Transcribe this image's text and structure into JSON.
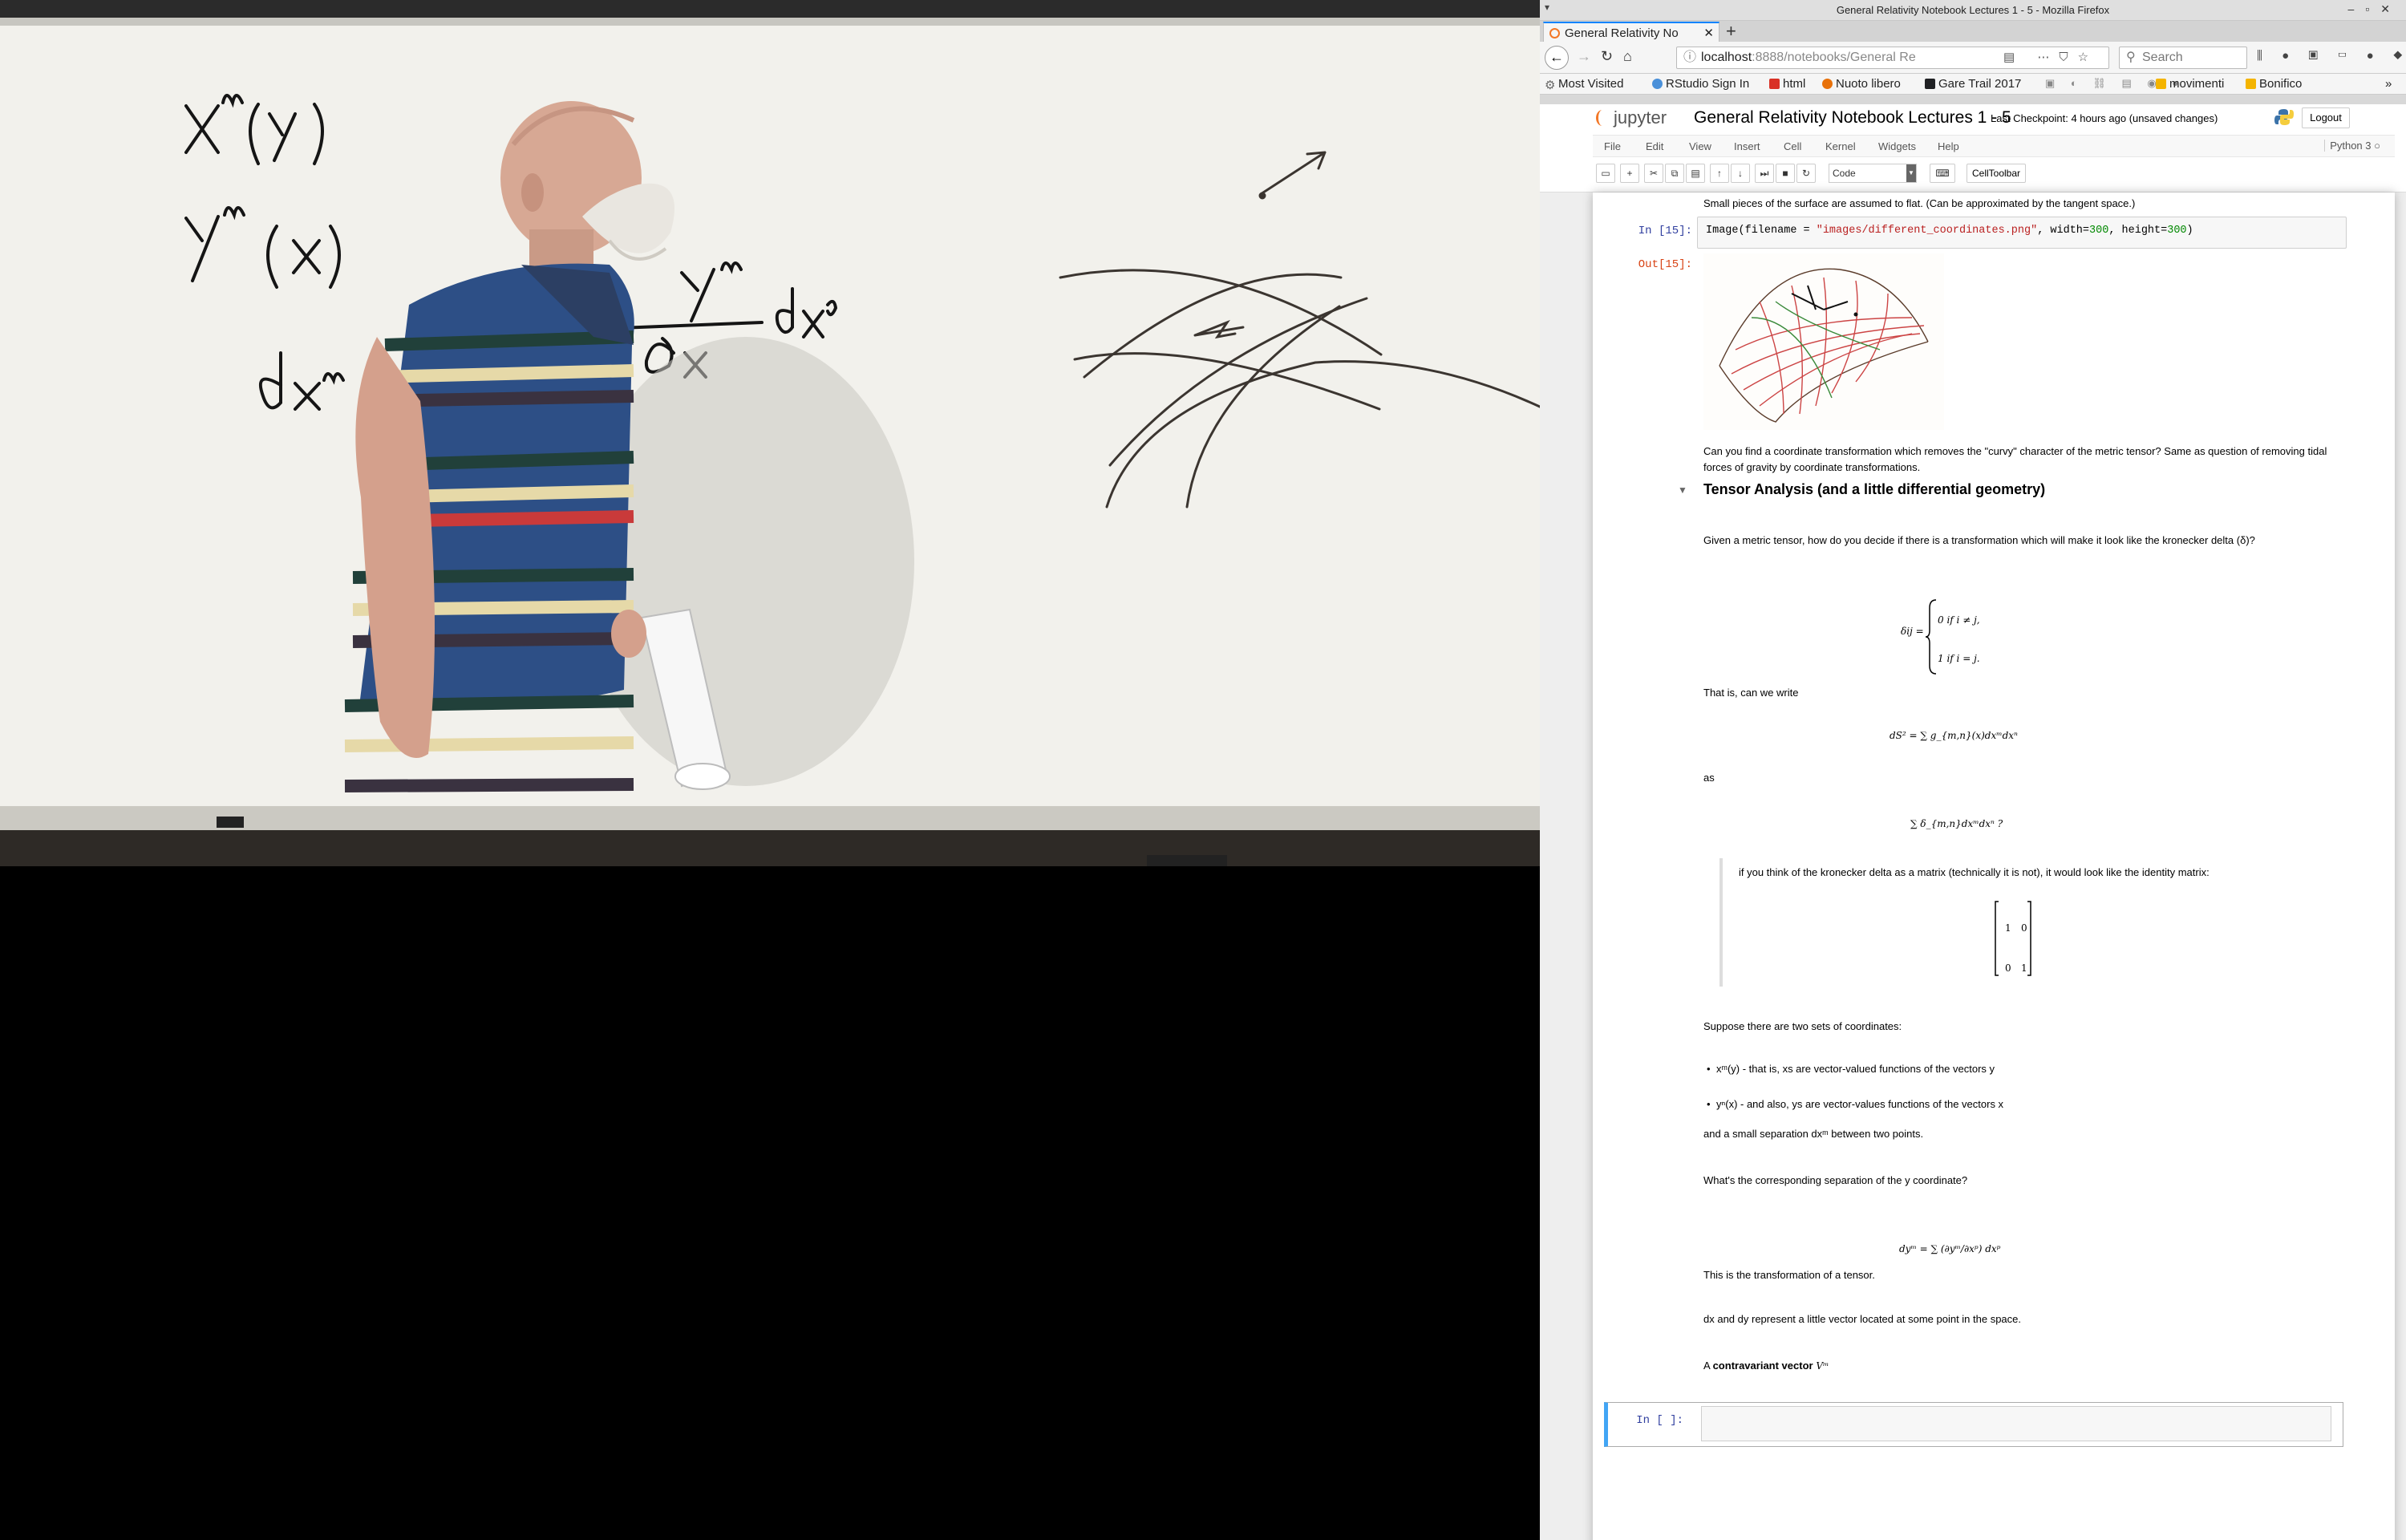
{
  "window": {
    "title": "General Relativity Notebook Lectures 1 - 5 - Mozilla Firefox"
  },
  "browser": {
    "tab_title": "General Relativity No",
    "url_host": "localhost",
    "url_rest": ":8888/notebooks/General Re",
    "search_placeholder": "Search",
    "bookmarks": [
      {
        "label": "Most Visited",
        "color": "#666666"
      },
      {
        "label": "RStudio Sign In",
        "color": "#4a90d9"
      },
      {
        "label": "html",
        "color": "#d93025"
      },
      {
        "label": "Nuoto libero",
        "color": "#e8710a"
      },
      {
        "label": "Gare Trail 2017",
        "color": "#202124"
      },
      {
        "label": "movimenti",
        "color": "#f4b400"
      },
      {
        "label": "Bonifico",
        "color": "#f4b400"
      }
    ]
  },
  "jupyter": {
    "logo_text": "jupyter",
    "notebook_title": "General Relativity Notebook Lectures 1 - 5",
    "checkpoint": "Last Checkpoint: 4 hours ago (unsaved changes)",
    "logout_label": "Logout",
    "menus": [
      "File",
      "Edit",
      "View",
      "Insert",
      "Cell",
      "Kernel",
      "Widgets",
      "Help"
    ],
    "kernel": "Python 3",
    "cell_type": "Code",
    "celltoolbar_label": "CellToolbar"
  },
  "cells": {
    "top_text": "Small pieces of the surface are assumed to flat. (Can be approximated by the tangent space.)",
    "in15_prompt": "In [15]:",
    "in15_code_a": "Image(filename = ",
    "in15_code_str": "\"images/different_coordinates.png\"",
    "in15_code_b": ", width=",
    "in15_code_n1": "300",
    "in15_code_c": ", height=",
    "in15_code_n2": "300",
    "in15_code_d": ")",
    "out15_prompt": "Out[15]:",
    "curvy_q": "Can you find a coordinate transformation which removes the \"curvy\" character of the metric tensor? Same as question of removing tidal forces of gravity by coordinate transformations.",
    "heading": "Tensor Analysis (and a little differential geometry)",
    "given_text": "Given a metric tensor, how do you decide if there is a transformation which will make it look like the kronecker delta (δ)?",
    "delta_lhs": "δij =",
    "delta_case0": "0   if i ≠ j,",
    "delta_case1": "1   if i = j.",
    "that_is": "That is, can we write",
    "ds2_eq": "dS² = ∑ g_{m,n}(x)dxᵐdxⁿ",
    "as_text": "as",
    "sum_delta": "∑ δ_{m,n}dxᵐdxⁿ ?",
    "quote_text": "if you think of the kronecker delta as a matrix (technically it is not), it would look like the identity matrix:",
    "matrix": [
      [
        "1",
        "0"
      ],
      [
        "0",
        "1"
      ]
    ],
    "suppose": "Suppose there are two sets of coordinates:",
    "bullet1": "xᵐ(y) - that is, xs are vector-valued functions of the vectors y",
    "bullet2": "yⁿ(x) - and also, ys are vector-values functions of the vectors x",
    "separation": "and a small separation dxᵐ between two points.",
    "whats": "What's the corresponding separation of the y coordinate?",
    "dy_eq": "dyᵐ = ∑ (∂yᵐ/∂xᵖ) dxᵖ",
    "transformation": "This is the transformation of a tensor.",
    "dxdy": "dx and dy represent a little vector located at some point in the space.",
    "contravariant_a": "A ",
    "contravariant_b": "contravariant vector",
    "contravariant_c": " Vᵐ",
    "empty_prompt": "In [ ]:"
  },
  "board": {
    "eq1": "Xᵐ(Y)",
    "eq2": "Yᵐ(X)",
    "eq3": "dXᵐ",
    "frac_num": "Yᵐ",
    "frac_den": "∂Xᵖ",
    "frac_rhs": "dXᵖ"
  }
}
